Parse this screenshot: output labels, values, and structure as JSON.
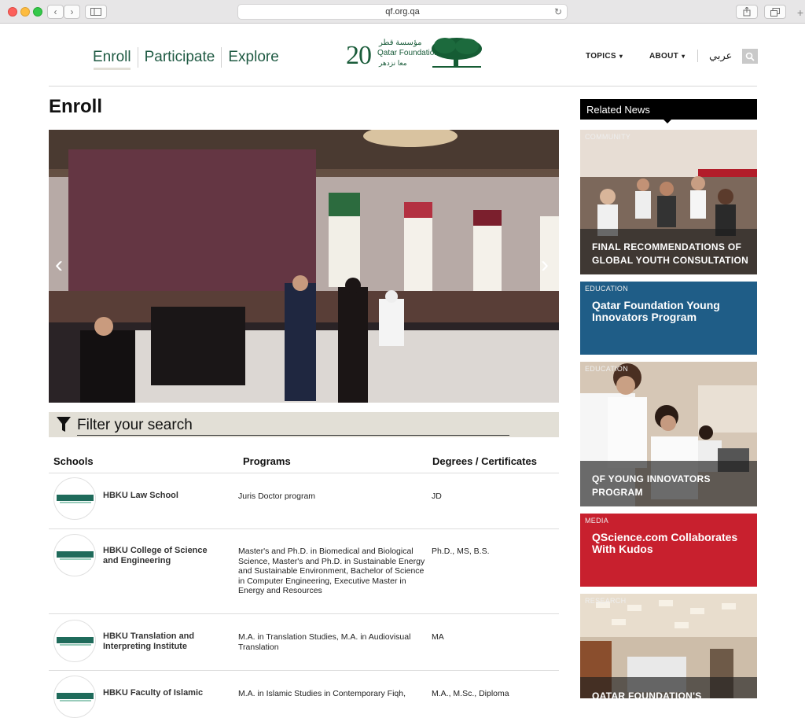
{
  "browser": {
    "url": "qf.org.qa"
  },
  "header": {
    "nav": [
      "Enroll",
      "Participate",
      "Explore"
    ],
    "logo": {
      "number": "20",
      "arabic_top": "مؤسسة قطر",
      "english": "Qatar Foundation",
      "arabic_bottom": "معا نزدهر"
    },
    "topics": "TOPICS",
    "about": "ABOUT",
    "language": "عربي"
  },
  "main": {
    "title": "Enroll",
    "filter_placeholder": "Filter your search",
    "columns": [
      "Schools",
      "Programs",
      "Degrees / Certificates"
    ],
    "rows": [
      {
        "school": "HBKU Law School",
        "program": "Juris Doctor program",
        "degree": "JD"
      },
      {
        "school": "HBKU College of Science and Engineering",
        "program": "Master's and Ph.D. in Biomedical and Biological Science, Master's and Ph.D. in Sustainable Energy and Sustainable Environment, Bachelor of Science in Computer Engineering, Executive Master in Energy and Resources",
        "degree": "Ph.D., MS, B.S."
      },
      {
        "school": "HBKU Translation and Interpreting Institute",
        "program": "M.A. in Translation Studies, M.A. in Audiovisual Translation",
        "degree": "MA"
      },
      {
        "school": "HBKU Faculty of Islamic",
        "program": "M.A. in Islamic Studies in Contemporary Fiqh,",
        "degree": "M.A., M.Sc., Diploma"
      }
    ]
  },
  "sidebar": {
    "heading": "Related News",
    "cards": [
      {
        "category": "COMMUNITY",
        "title": "FINAL RECOMMENDATIONS OF GLOBAL YOUTH CONSULTATION"
      },
      {
        "category": "EDUCATION",
        "title": "Qatar Foundation Young Innovators Program",
        "color": "#1f5d87"
      },
      {
        "category": "EDUCATION",
        "title": "QF YOUNG INNOVATORS PROGRAM"
      },
      {
        "category": "MEDIA",
        "title": "QScience.com Collaborates With Kudos",
        "color": "#c8202e"
      },
      {
        "category": "RESEARCH",
        "title": "QATAR FOUNDATION'S"
      }
    ]
  }
}
